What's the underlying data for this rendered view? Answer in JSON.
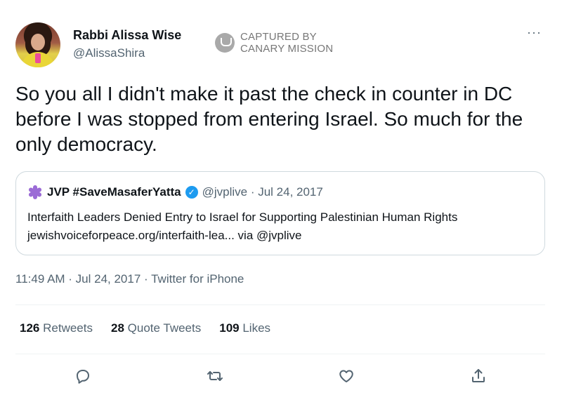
{
  "author": {
    "name": "Rabbi Alissa Wise",
    "handle": "@AlissaShira"
  },
  "watermark": {
    "line1": "CAPTURED BY",
    "line2": "CANARY MISSION"
  },
  "more_menu": "···",
  "tweet": {
    "text": "So you all I didn't make it past the check in counter in DC before I was stopped from entering Israel. So much for the only democracy.",
    "timestamp": "11:49 AM · Jul 24, 2017 · Twitter for iPhone"
  },
  "quoted": {
    "name": "JVP #SaveMasaferYatta",
    "verified_mark": "✓",
    "meta": "@jvplive · Jul 24, 2017",
    "text": "Interfaith Leaders Denied Entry to Israel for Supporting Palestinian Human Rights jewishvoiceforpeace.org/interfaith-lea... via @jvplive"
  },
  "stats": [
    {
      "count": "126",
      "label": "Retweets"
    },
    {
      "count": "28",
      "label": "Quote Tweets"
    },
    {
      "count": "109",
      "label": "Likes"
    }
  ],
  "actions": [
    "reply-icon",
    "retweet-icon",
    "like-icon",
    "share-icon"
  ],
  "colors": {
    "text": "#0f1419",
    "secondary": "#536471",
    "verified": "#1d9bf0",
    "border": "#cfd9de",
    "divider": "#eff3f4"
  }
}
